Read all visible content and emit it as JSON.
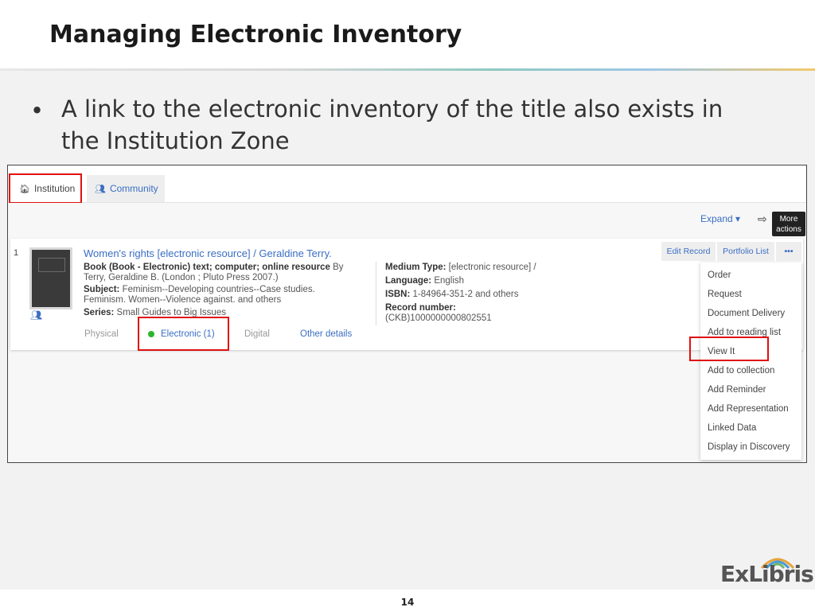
{
  "slide": {
    "title": "Managing Electronic Inventory",
    "bullet": "A link to the electronic inventory of the title also exists in the Institution Zone",
    "page_number": "14",
    "logo_text": "ExLibris"
  },
  "tabs": {
    "institution": "Institution",
    "community": "Community"
  },
  "toolbar": {
    "expand": "Expand ▾",
    "tooltip": "More actions"
  },
  "record": {
    "index": "1",
    "title": "Women's rights [electronic resource] / Geraldine Terry.",
    "book_label": "Book (Book - Electronic) text; computer; online resource",
    "book_value": " By Terry, Geraldine B. (London ; Pluto Press 2007.)",
    "subject_label": "Subject:",
    "subject_value": " Feminism--Developing countries--Case studies. Feminism. Women--Violence against. and others",
    "series_label": "Series:",
    "series_value": " Small Guides to Big Issues",
    "medium_label": "Medium Type:",
    "medium_value": " [electronic resource] /",
    "language_label": "Language:",
    "language_value": " English",
    "isbn_label": "ISBN:",
    "isbn_value": " 1-84964-351-2 and others",
    "record_label": "Record number:",
    "record_value": "(CKB)1000000000802551",
    "links": {
      "physical": "Physical",
      "electronic": "Electronic (1)",
      "digital": "Digital",
      "other": "Other details"
    },
    "buttons": {
      "edit": "Edit Record",
      "portfolio": "Portfolio List",
      "more": "•••"
    }
  },
  "menu": {
    "items": [
      "Order",
      "Request",
      "Document Delivery",
      "Add to reading list",
      "View It",
      "Add to collection",
      "Add Reminder",
      "Add Representation",
      "Linked Data",
      "Display in Discovery"
    ]
  },
  "colors": {
    "link": "#3a6ec4",
    "highlight": "#e01010",
    "available": "#2cb52c"
  }
}
